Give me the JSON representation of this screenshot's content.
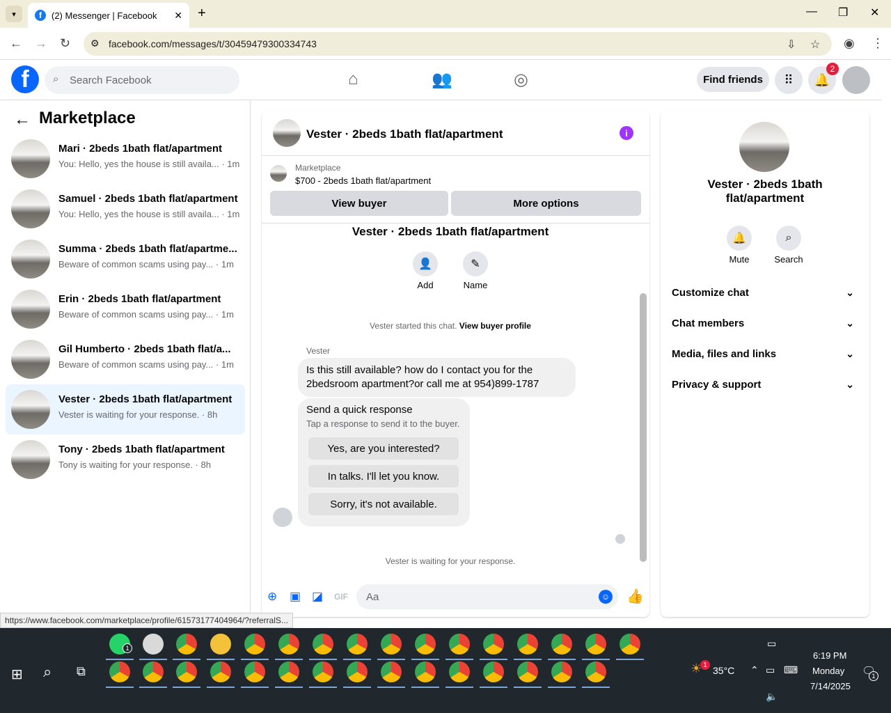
{
  "browser": {
    "tab_title": "(2) Messenger | Facebook",
    "url": "facebook.com/messages/t/30459479300334743",
    "status_url": "https://www.facebook.com/marketplace/profile/61573177404964/?referralS..."
  },
  "fb": {
    "search_placeholder": "Search Facebook",
    "find_friends": "Find friends",
    "notif_count": "2"
  },
  "left": {
    "title": "Marketplace",
    "conversations": [
      {
        "name": "Mari · 2beds 1bath flat/apartment",
        "snippet": "You: Hello, yes the house is still availa... · 1m"
      },
      {
        "name": "Samuel · 2beds 1bath flat/apartment",
        "snippet": "You: Hello, yes the house is still availa... · 1m"
      },
      {
        "name": "Summa · 2beds 1bath flat/apartme...",
        "snippet": "Beware of common scams using pay... · 1m"
      },
      {
        "name": "Erin · 2beds 1bath flat/apartment",
        "snippet": "Beware of common scams using pay... · 1m"
      },
      {
        "name": "Gil Humberto · 2beds 1bath flat/a...",
        "snippet": "Beware of common scams using pay... · 1m"
      },
      {
        "name": "Vester · 2beds 1bath flat/apartment",
        "snippet": "Vester is waiting for your response. · 8h"
      },
      {
        "name": "Tony · 2beds 1bath flat/apartment",
        "snippet": "Tony is waiting for your response. · 8h"
      }
    ]
  },
  "chat": {
    "title": "Vester · 2beds 1bath flat/apartment",
    "marketplace_label": "Marketplace",
    "listing": "$700 - 2beds 1bath flat/apartment",
    "view_buyer": "View buyer",
    "more_options": "More options",
    "thread_title": "Vester · 2beds 1bath flat/apartment",
    "add_label": "Add",
    "name_label": "Name",
    "started_text": "Vester started this chat.",
    "view_profile": "View buyer profile",
    "sender": "Vester",
    "message": "Is this still available? how do I contact you for the 2bedsroom apartment?or call me at 954)899-1787",
    "qr_title": "Send a quick response",
    "qr_sub": "Tap a response to send it to the buyer.",
    "qr_options": [
      "Yes, are you interested?",
      "In talks. I'll let you know.",
      "Sorry, it's not available."
    ],
    "waiting": "Vester is waiting for your response.",
    "composer_placeholder": "Aa"
  },
  "right": {
    "name": "Vester · 2beds 1bath flat/apartment",
    "mute": "Mute",
    "search": "Search",
    "rows": [
      "Customize chat",
      "Chat members",
      "Media, files and links",
      "Privacy & support"
    ]
  },
  "taskbar": {
    "temp": "35°C",
    "time": "6:19 PM",
    "day": "Monday",
    "date": "7/14/2025",
    "whatsapp_badge": "1",
    "weather_badge": "1",
    "notif_badge": "1"
  }
}
